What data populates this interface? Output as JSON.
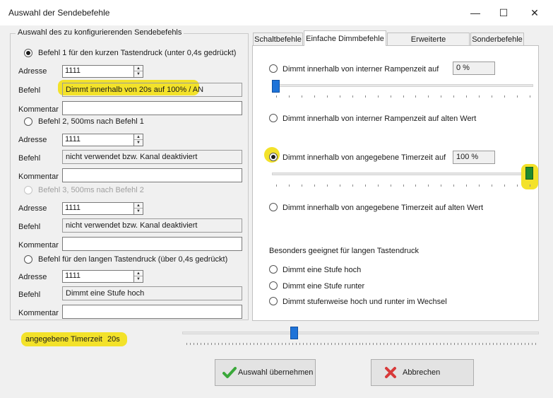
{
  "window": {
    "title": "Auswahl der Sendebefehle",
    "minimize": "—",
    "maximize": "☐",
    "close": "✕"
  },
  "group": {
    "title": "Auswahl des zu konfigurierenden Sendebefehls",
    "befehle": [
      {
        "radio_label": "Befehl 1 für den kurzen Tastendruck (unter 0,4s gedrückt)",
        "selected": true,
        "enabled": true,
        "adresse": "1111",
        "befehl": "Dimmt innerhalb von 20s auf 100% / AN",
        "kommentar": ""
      },
      {
        "radio_label": "Befehl 2, 500ms nach Befehl 1",
        "selected": false,
        "enabled": true,
        "adresse": "1111",
        "befehl": "nicht verwendet bzw. Kanal deaktiviert",
        "kommentar": ""
      },
      {
        "radio_label": "Befehl 3, 500ms nach Befehl 2",
        "selected": false,
        "enabled": false,
        "adresse": "1111",
        "befehl": "nicht verwendet bzw. Kanal deaktiviert",
        "kommentar": ""
      },
      {
        "radio_label": "Befehl für den langen Tastendruck (über 0,4s gedrückt)",
        "selected": false,
        "enabled": true,
        "adresse": "1111",
        "befehl": "Dimmt eine Stufe hoch",
        "kommentar": ""
      }
    ],
    "labels": {
      "adresse": "Adresse",
      "befehl": "Befehl",
      "kommentar": "Kommentar"
    }
  },
  "tabs": [
    {
      "label": "Schaltbefehle",
      "selected": false
    },
    {
      "label": "Einfache Dimmbefehle",
      "selected": true
    },
    {
      "label": "Erweiterte Dimmbefehle",
      "selected": false
    },
    {
      "label": "Sonderbefehle",
      "selected": false
    }
  ],
  "dimm": {
    "option1": {
      "label": "Dimmt innerhalb von interner Rampenzeit auf",
      "selected": false,
      "value": "0 %",
      "slider_level": 0.0
    },
    "option2": {
      "label": "Dimmt innerhalb von interner Rampenzeit  auf alten Wert",
      "selected": false
    },
    "option3": {
      "label": "Dimmt innerhalb von angegebene Timerzeit auf",
      "selected": true,
      "value": "100 %",
      "slider_level": 1.0
    },
    "option4": {
      "label": "Dimmt innerhalb von angegebene Timerzeit auf alten Wert",
      "selected": false
    },
    "section_title": "Besonders geeignet für langen Tastendruck",
    "stufe_hoch": "Dimmt eine Stufe hoch",
    "stufe_runter": "Dimmt eine Stufe runter",
    "wechsel": "Dimmt stufenweise hoch und runter im Wechsel"
  },
  "timer": {
    "label": "angegebene Timerzeit",
    "value": "20s",
    "slider_level": 0.32
  },
  "buttons": {
    "ok": "Auswahl übernehmen",
    "cancel": "Abbrechen"
  },
  "colors": {
    "highlight": "#f3e22a",
    "thumb_blue": "#1e73d8",
    "thumb_green": "#1f8a2e",
    "ok_check": "#3aa83a",
    "cancel_x": "#d83a3a"
  }
}
